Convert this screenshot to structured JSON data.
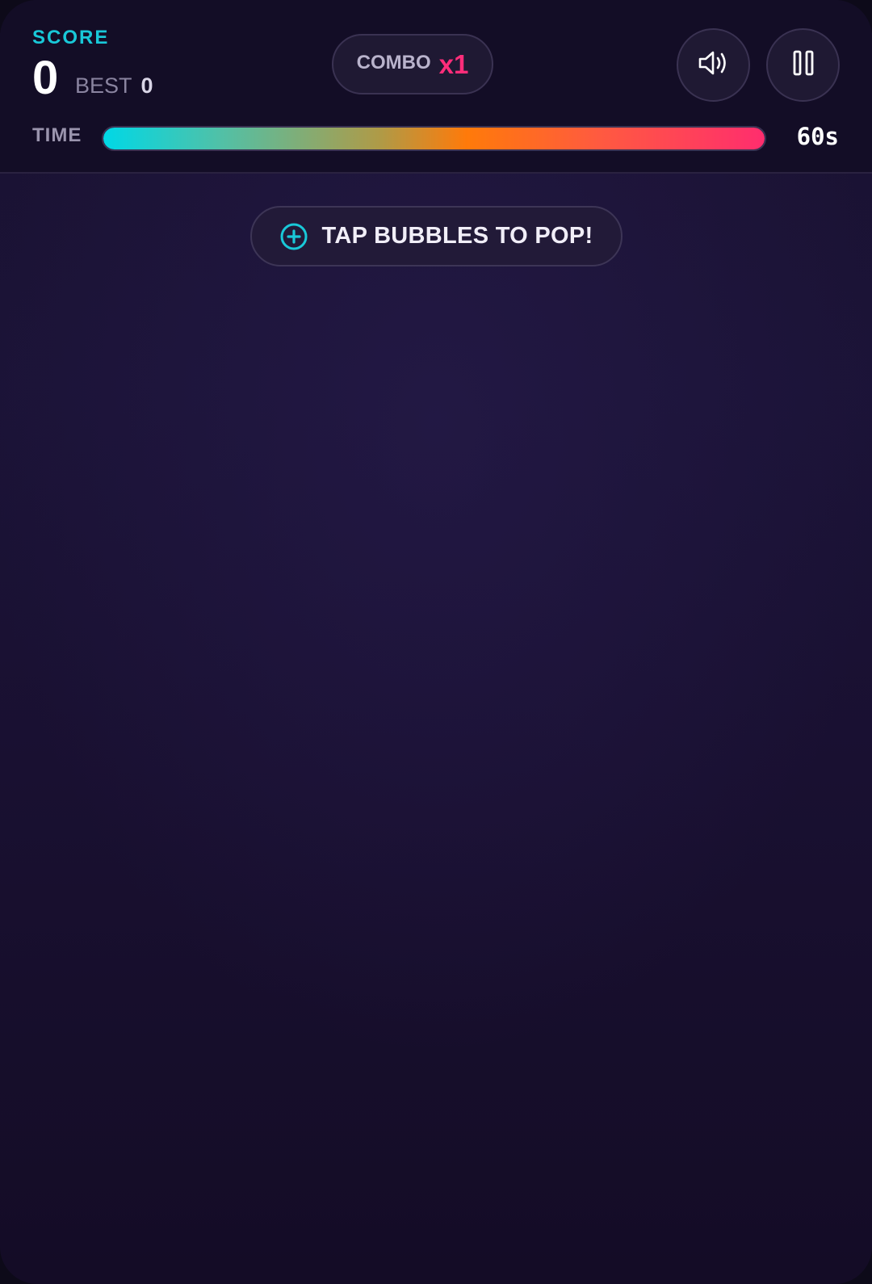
{
  "hud": {
    "score_label": "SCORE",
    "score_value": "0",
    "best_label": "BEST",
    "best_value": "0",
    "combo_label": "COMBO",
    "combo_value": "x1",
    "time_label": "TIME",
    "time_value": "60s",
    "time_remaining_fraction": 1.0
  },
  "controls": {
    "sound_icon": "speaker-icon",
    "pause_icon": "pause-icon"
  },
  "hint": {
    "icon": "plus-circle-icon",
    "text": "TAP BUBBLES TO POP!"
  },
  "colors": {
    "score_accent": "#19c8d8",
    "combo_accent": "#ff2d7a",
    "background": "#1b1337",
    "timer_gradient": [
      "#00d8e6",
      "#ff7a0a",
      "#ff2d6e"
    ]
  }
}
